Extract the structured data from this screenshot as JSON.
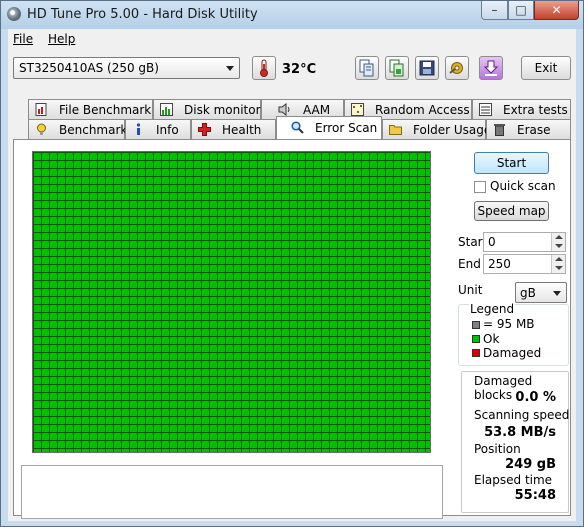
{
  "window": {
    "title": "HD Tune Pro 5.00 - Hard Disk Utility",
    "controls": {
      "minimize": "–",
      "maximize": "□",
      "close": "✕"
    }
  },
  "menu": [
    {
      "label": "File"
    },
    {
      "label": "Help"
    }
  ],
  "toolbar": {
    "drive": "ST3250410AS (250 gB)",
    "temperature": "32°C",
    "exit_label": "Exit",
    "icons": [
      "copy-info-icon",
      "copy-screenshot-icon",
      "save-icon",
      "options-icon",
      "download-icon"
    ]
  },
  "tabs": {
    "top_row": [
      {
        "label": "File Benchmark",
        "icon": "file-benchmark-icon"
      },
      {
        "label": "Disk monitor",
        "icon": "disk-monitor-icon"
      },
      {
        "label": "AAM",
        "icon": "speaker-icon"
      },
      {
        "label": "Random Access",
        "icon": "random-access-icon"
      },
      {
        "label": "Extra tests",
        "icon": "extra-tests-icon"
      }
    ],
    "bottom_row": [
      {
        "label": "Benchmark",
        "icon": "benchmark-icon"
      },
      {
        "label": "Info",
        "icon": "info-icon"
      },
      {
        "label": "Health",
        "icon": "health-icon"
      },
      {
        "label": "Error Scan",
        "icon": "magnifier-icon",
        "active": true
      },
      {
        "label": "Folder Usage",
        "icon": "folder-icon"
      },
      {
        "label": "Erase",
        "icon": "trash-icon"
      }
    ]
  },
  "scan": {
    "start_label": "Start",
    "quick_scan_label": "Quick scan",
    "quick_scan_checked": false,
    "speed_map_label": "Speed map",
    "start_field_label": "Start",
    "start_value": "0",
    "end_field_label": "End",
    "end_value": "250",
    "unit_label": "Unit",
    "unit_value": "gB",
    "grid_status": "all blocks ok"
  },
  "legend": {
    "title": "Legend",
    "items": [
      {
        "label": "= 95 MB",
        "color": "#808080"
      },
      {
        "label": "Ok",
        "color": "#00c000"
      },
      {
        "label": "Damaged",
        "color": "#e00000"
      }
    ]
  },
  "stats": {
    "damaged_blocks_label": "Damaged blocks",
    "damaged_blocks_value": "0.0 %",
    "scanning_speed_label": "Scanning speed",
    "scanning_speed_value": "53.8 MB/s",
    "position_label": "Position",
    "position_value": "249 gB",
    "elapsed_time_label": "Elapsed time",
    "elapsed_time_value": "55:48"
  }
}
